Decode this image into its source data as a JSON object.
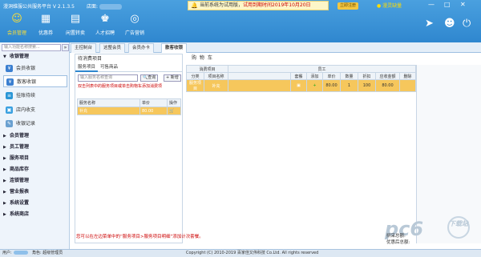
{
  "app": {
    "title": "漫洞维服公共服务平台 V 2.1.3.5",
    "store_label": "店面:"
  },
  "notice": {
    "pre": "当前系统为试用版，",
    "red": "试用到期时间2019年10月20日",
    "btn": "立即注册"
  },
  "user": {
    "name": "漫灵缺量"
  },
  "nav": [
    {
      "label": "会员管理",
      "icon": "☺"
    },
    {
      "label": "优惠券",
      "icon": "▦"
    },
    {
      "label": "闲置转卖",
      "icon": "▤"
    },
    {
      "label": "人才招聘",
      "icon": "♚"
    },
    {
      "label": "广告营销",
      "icon": "◎"
    }
  ],
  "tabs": [
    "主控制台",
    "这整会员",
    "会员办卡",
    "散客收银"
  ],
  "sidebar": {
    "search_placeholder": "输入功能名称搜索...",
    "go": "»",
    "groups": [
      {
        "label": "收银管理",
        "items": [
          {
            "label": "会员收银",
            "color": "#3b7fd0"
          },
          {
            "label": "散客收银",
            "color": "#3b7fd0"
          },
          {
            "label": "挂账待续",
            "color": "#2a96d6"
          },
          {
            "label": "店内收支",
            "color": "#3aa0e0"
          },
          {
            "label": "收银记录",
            "color": "#6aa0d0"
          }
        ]
      },
      {
        "label": "会员管理"
      },
      {
        "label": "员工管理"
      },
      {
        "label": "服务项目"
      },
      {
        "label": "商品库存"
      },
      {
        "label": "连锁管理"
      },
      {
        "label": "营业报表"
      },
      {
        "label": "系统设置"
      },
      {
        "label": "系统商店"
      }
    ]
  },
  "consume": {
    "title": "待消费项目",
    "tabs": [
      "服务项目",
      "可售商品"
    ],
    "search_placeholder": "输入服务名称查询",
    "query": "查询",
    "add": "+ 新增",
    "hint": "双击列表中的服务项目或单击购物车添加消费项",
    "headers": [
      "服务名称",
      "单价",
      "操作"
    ],
    "rows": [
      {
        "name": "补充",
        "price": "80.00",
        "op": "🛒"
      }
    ]
  },
  "cart": {
    "title": "购 物 车",
    "group_item": "消费项目",
    "group_emp": "员工",
    "h": [
      "分类",
      "项目名称",
      "",
      "套餐",
      "添加",
      "单价",
      "数量",
      "折扣",
      "应收金额",
      "删除"
    ],
    "row": [
      "服务项目",
      "补充",
      "",
      "▣",
      "+",
      "80.00",
      "1",
      "100",
      "80.00",
      ""
    ]
  },
  "bottom": {
    "msg": "您可以在左边菜单中的“服务项目>服务项目明细”添加计次套餐。",
    "t1": "拼采总额:",
    "t2": "优惠后总额:"
  },
  "status": {
    "left": "用户:",
    "role": "角色: 超级管理员",
    "copy": "Copyright (C) 2010-2019 百家佳又伟科技 Co.Ltd. All rights reserved"
  },
  "watermark": {
    "text": "pc6",
    "dl": "下载站"
  }
}
